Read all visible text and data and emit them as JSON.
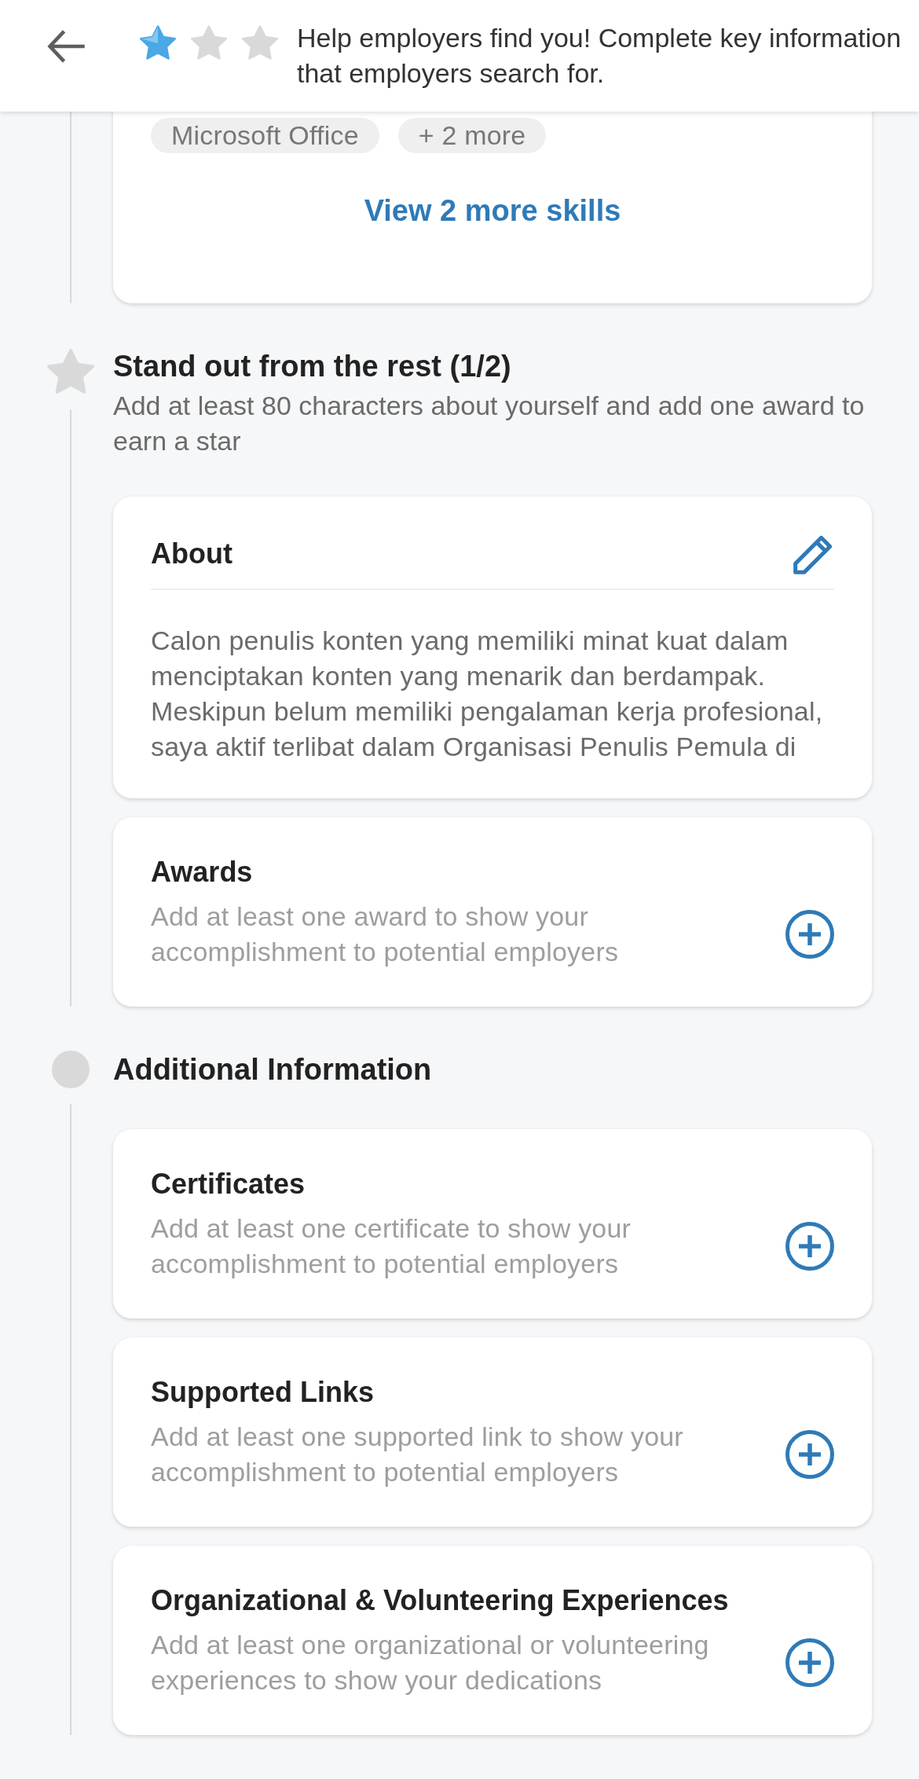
{
  "header": {
    "stars": 1,
    "message": "Help employers find you! Complete key information that employers search for."
  },
  "skills_card": {
    "chips": [
      "Microsoft Office",
      "+ 2 more"
    ],
    "link": "View 2 more skills"
  },
  "sections": [
    {
      "kind": "star",
      "title": "Stand out from the rest (1/2)",
      "subtitle": "Add at least 80 characters about yourself and add one award to earn a star",
      "cards": [
        {
          "kind": "text",
          "title": "About",
          "body": "Calon penulis konten yang memiliki minat kuat dalam menciptakan konten yang menarik dan berdampak. Meskipun belum memiliki pengalaman kerja profesional, saya aktif terlibat dalam Organisasi Penulis Pemula di"
        },
        {
          "kind": "add",
          "title": "Awards",
          "hint": "Add at least one award to show your accomplishment to potential employers"
        }
      ]
    },
    {
      "kind": "dot",
      "title": "Additional Information",
      "cards": [
        {
          "kind": "add",
          "title": "Certificates",
          "hint": "Add at least one certificate to show your accomplishment to potential employers"
        },
        {
          "kind": "add",
          "title": "Supported Links",
          "hint": "Add at least one supported link to show your accomplishment to potential employers"
        },
        {
          "kind": "add",
          "title": "Organizational & Volunteering Experiences",
          "hint": "Add at least one organizational or volunteering experiences to show your dedications"
        }
      ]
    }
  ]
}
